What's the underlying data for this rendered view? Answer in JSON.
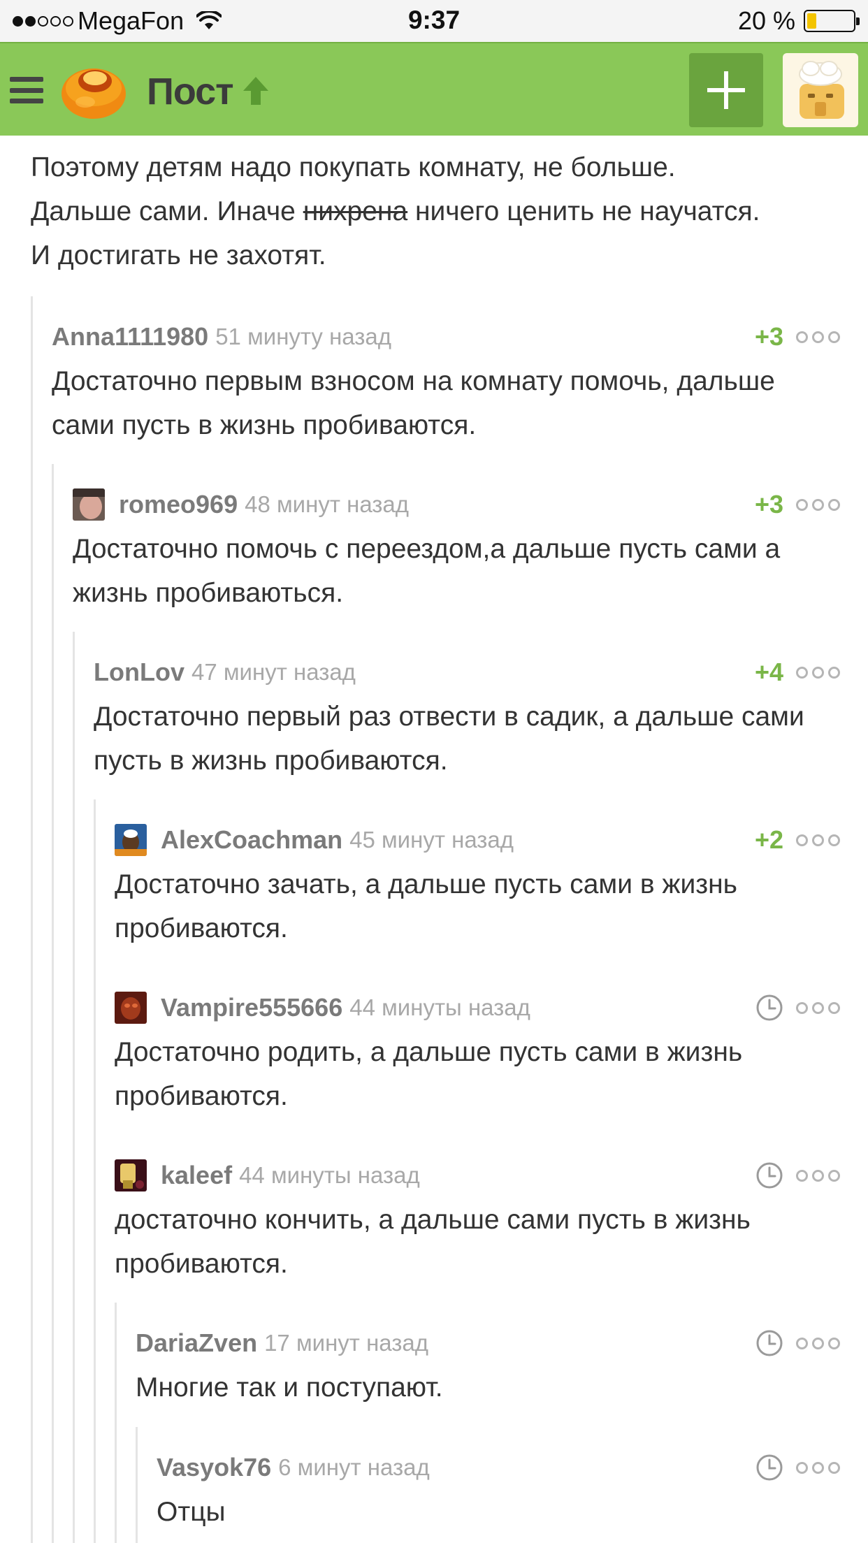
{
  "status_bar": {
    "carrier": "MegaFon",
    "time": "9:37",
    "battery_text": "20 %",
    "battery_level": 0.2,
    "signal_bars_filled": 2,
    "signal_bars_total": 5
  },
  "header": {
    "title": "Пост",
    "brand_color": "#8ac858",
    "icons": [
      "menu-icon",
      "logo-icon",
      "arrow-up-icon",
      "plus-icon",
      "profile-icon"
    ]
  },
  "post": {
    "line1": "Поэтому детям надо покупать комнату, не больше.",
    "line2_before": "Дальше сами. Иначе ",
    "line2_strike": "нихрена",
    "line2_after": " ничего ценить не научатся.",
    "line3": "И достигать не захотят."
  },
  "comments": [
    {
      "author": "Anna1111980",
      "time": "51 минуту назад",
      "rating": "+3",
      "text": "Достаточно первым взносом на комнату помочь, дальше сами пусть в жизнь пробиваются."
    },
    {
      "author": "romeo969",
      "time": "48 минут назад",
      "rating": "+3",
      "text": "Достаточно помочь с переездом,а дальше пусть сами а жизнь пробиваються."
    },
    {
      "author": "LonLov",
      "time": "47 минут назад",
      "rating": "+4",
      "text": "Достаточно первый раз отвести в садик, а дальше сами пусть в жизнь пробиваются."
    },
    {
      "author": "AlexCoachman",
      "time": "45 минут назад",
      "rating": "+2",
      "text": "Достаточно зачать, а дальше пусть сами в жизнь пробиваются."
    },
    {
      "author": "Vampire555666",
      "time": "44 минуты назад",
      "rating": "",
      "text": "Достаточно родить, а дальше пусть сами в жизнь пробиваются."
    },
    {
      "author": "kaleef",
      "time": "44 минуты назад",
      "rating": "",
      "text": "достаточно кончить, а дальше сами пусть в жизнь пробиваются."
    },
    {
      "author": "DariaZven",
      "time": "17 минут назад",
      "rating": "",
      "text": "Многие так и поступают."
    },
    {
      "author": "Vasyok76",
      "time": "6 минут назад",
      "rating": "",
      "text": "Отцы"
    }
  ]
}
